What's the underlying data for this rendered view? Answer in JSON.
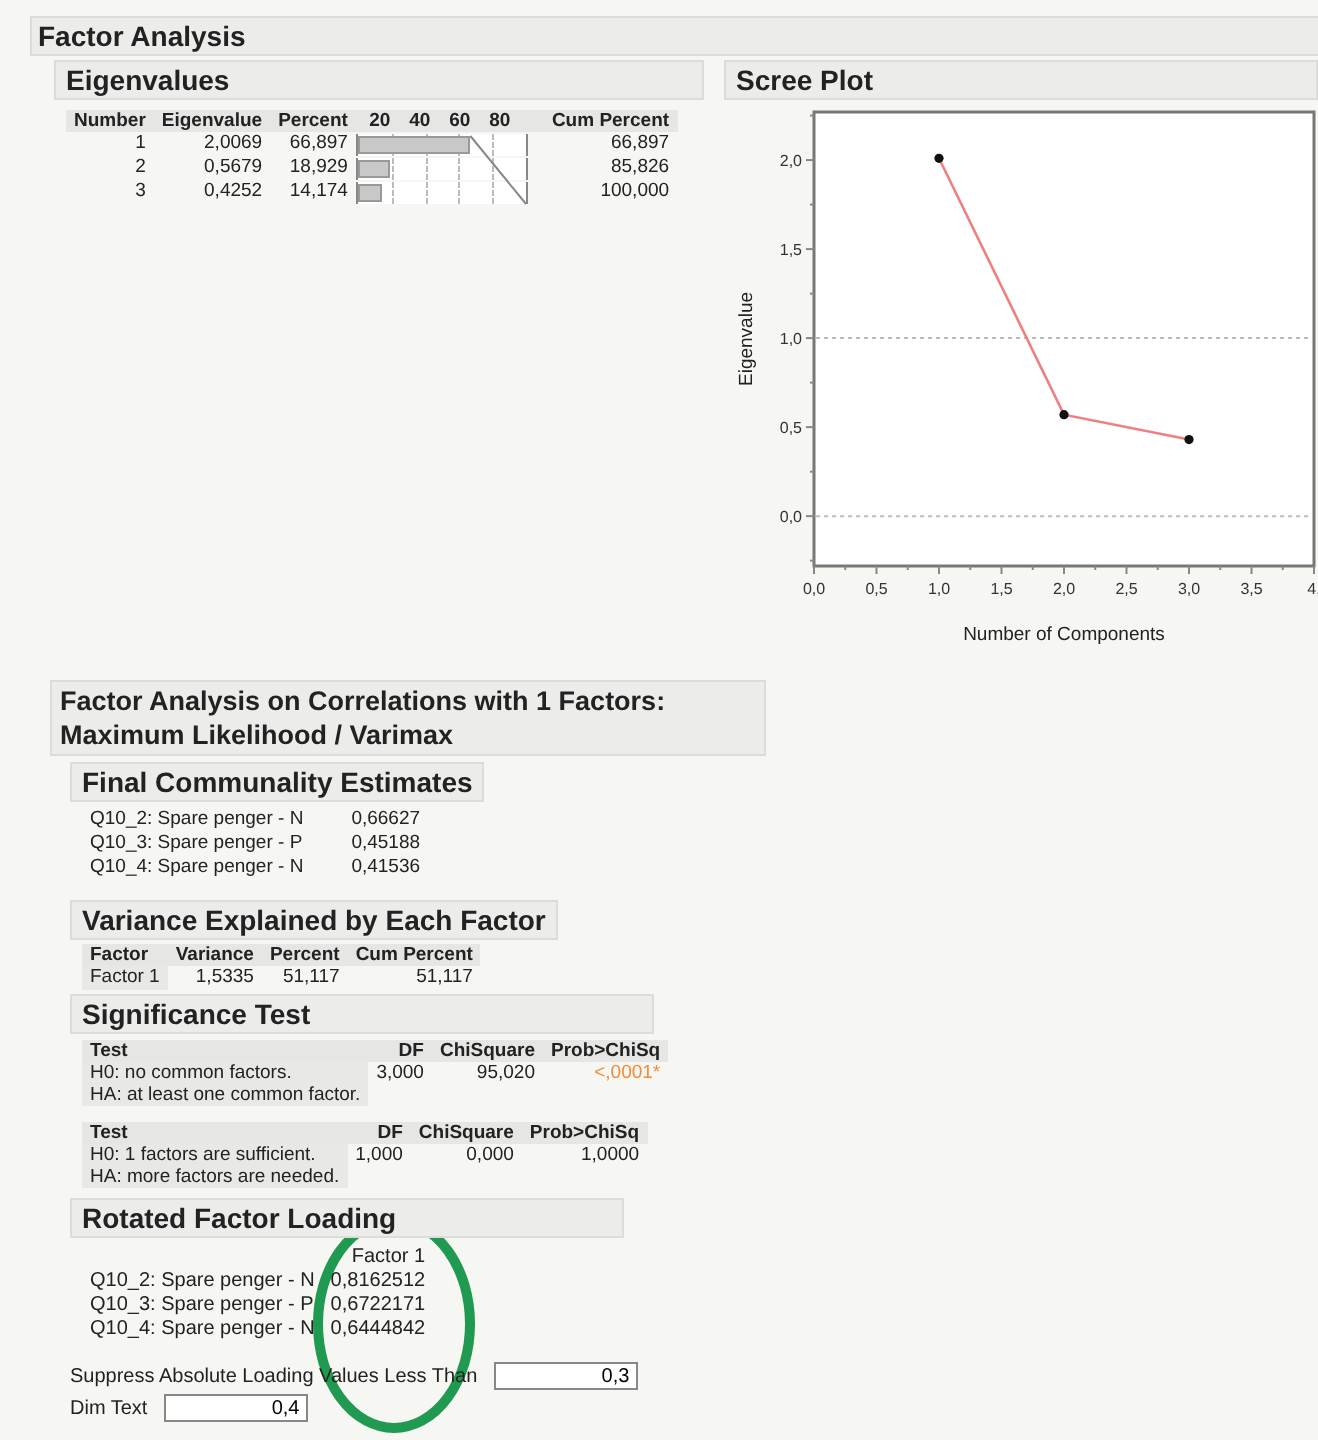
{
  "title": "Factor Analysis",
  "eigenvalues": {
    "title": "Eigenvalues",
    "columns": [
      "Number",
      "Eigenvalue",
      "Percent",
      "Cum Percent"
    ],
    "bar_axis": [
      "20",
      "40",
      "60",
      "80"
    ],
    "rows": [
      {
        "number": "1",
        "eigenvalue": "2,0069",
        "percent": "66,897",
        "level": 0.669,
        "cum_percent": "66,897"
      },
      {
        "number": "2",
        "eigenvalue": "0,5679",
        "percent": "18,929",
        "level": 0.189,
        "cum_percent": "85,826"
      },
      {
        "number": "3",
        "eigenvalue": "0,4252",
        "percent": "14,174",
        "level": 0.142,
        "cum_percent": "100,000"
      }
    ]
  },
  "scree_plot": {
    "title": "Scree Plot",
    "chart_data": {
      "type": "line",
      "xlabel": "Number of Components",
      "ylabel": "Eigenvalue",
      "x": [
        1,
        2,
        3
      ],
      "series": [
        {
          "color": "#f08080",
          "marker": "circle",
          "values": [
            2.01,
            0.57,
            0.43
          ]
        }
      ],
      "xlim": [
        0,
        4
      ],
      "ylim": [
        -0.28,
        2.27
      ],
      "xticks": [
        {
          "value": 0,
          "label": "0,0"
        },
        {
          "value": 0.5,
          "label": "0,5"
        },
        {
          "value": 1,
          "label": "1,0"
        },
        {
          "value": 1.5,
          "label": "1,5"
        },
        {
          "value": 2,
          "label": "2,0"
        },
        {
          "value": 2.5,
          "label": "2,5"
        },
        {
          "value": 3,
          "label": "3,0"
        },
        {
          "value": 3.5,
          "label": "3,5"
        },
        {
          "value": 4,
          "label": "4,"
        }
      ],
      "yticks": [
        {
          "value": 0,
          "label": "0,0"
        },
        {
          "value": 0.5,
          "label": "0,5"
        },
        {
          "value": 1,
          "label": "1,0"
        },
        {
          "value": 1.5,
          "label": "1,5"
        },
        {
          "value": 2,
          "label": "2,0"
        }
      ]
    }
  },
  "analysis": {
    "title": "Factor Analysis on Correlations with 1 Factors: Maximum Likelihood / Varimax",
    "communality": {
      "title": "Final Communality Estimates",
      "rows": [
        {
          "variable": "Q10_2: Spare penger - N",
          "estimate": "0,66627"
        },
        {
          "variable": "Q10_3: Spare penger - P",
          "estimate": "0,45188"
        },
        {
          "variable": "Q10_4: Spare penger - N",
          "estimate": "0,41536"
        }
      ]
    },
    "variance": {
      "title": "Variance Explained by Each Factor",
      "columns": [
        "Factor",
        "Variance",
        "Percent",
        "Cum Percent"
      ],
      "rows": [
        {
          "factor": "Factor 1",
          "variance": "1,5335",
          "percent": "51,117",
          "cum_percent": "51,117"
        }
      ]
    },
    "significance": {
      "title": "Significance Test",
      "tests": [
        {
          "columns": [
            "Test",
            "DF",
            "ChiSquare",
            "Prob>ChiSq"
          ],
          "h0": "H0: no common factors.",
          "ha": "HA: at least one common factor.",
          "df": "3,000",
          "chisquare": "95,020",
          "prob": "<,0001*",
          "significant": true
        },
        {
          "columns": [
            "Test",
            "DF",
            "ChiSquare",
            "Prob>ChiSq"
          ],
          "h0": "H0: 1 factors are sufficient.",
          "ha": "HA: more factors are needed.",
          "df": "1,000",
          "chisquare": "0,000",
          "prob": "1,0000",
          "significant": false
        }
      ]
    },
    "loadings": {
      "title": "Rotated Factor Loading",
      "column": "Factor 1",
      "rows": [
        {
          "variable": "Q10_2: Spare penger - N",
          "loading": "0,8162512"
        },
        {
          "variable": "Q10_3: Spare penger - P",
          "loading": "0,6722171"
        },
        {
          "variable": "Q10_4: Spare penger - N",
          "loading": "0,6444842"
        }
      ]
    },
    "suppress": {
      "label": "Suppress Absolute Loading Values Less Than",
      "value": "0,3"
    },
    "dim": {
      "label": "Dim Text",
      "value": "0,4"
    }
  }
}
